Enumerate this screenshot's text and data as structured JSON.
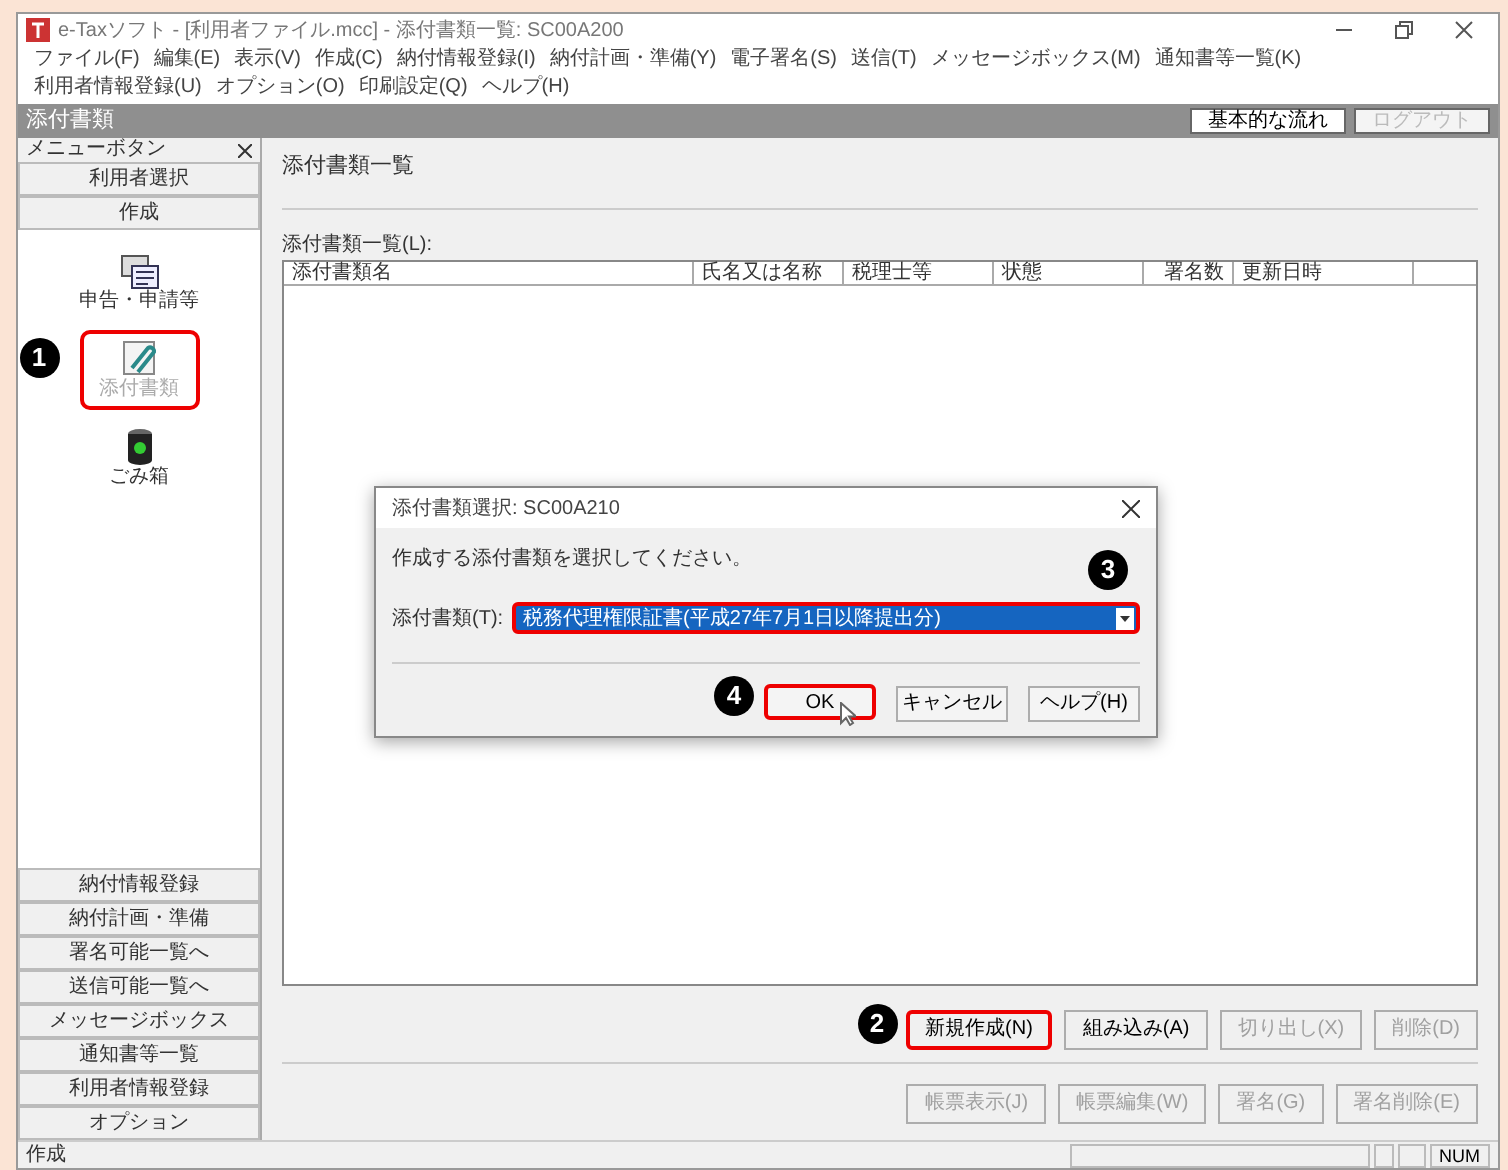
{
  "window": {
    "title": "e-Taxソフト - [利用者ファイル.mcc] - 添付書類一覧: SC00A200"
  },
  "menu": [
    "ファイル(F)",
    "編集(E)",
    "表示(V)",
    "作成(C)",
    "納付情報登録(I)",
    "納付計画・準備(Y)",
    "電子署名(S)",
    "送信(T)",
    "メッセージボックス(M)",
    "通知書等一覧(K)",
    "利用者情報登録(U)",
    "オプション(O)",
    "印刷設定(Q)",
    "ヘルプ(H)"
  ],
  "header": {
    "title": "添付書類",
    "buttons": [
      {
        "label": "基本的な流れ",
        "disabled": false
      },
      {
        "label": "ログアウト",
        "disabled": true
      }
    ]
  },
  "sidebar": {
    "title": "メニューボタン",
    "top_buttons": [
      "利用者選択",
      "作成"
    ],
    "items": [
      {
        "label": "申告・申請等",
        "kind": "forms",
        "selected": false,
        "highlighted": false
      },
      {
        "label": "添付書類",
        "kind": "clip",
        "selected": true,
        "highlighted": true,
        "annotation": "1"
      },
      {
        "label": "ごみ箱",
        "kind": "trash",
        "selected": false,
        "highlighted": false
      }
    ],
    "bottom_buttons": [
      "納付情報登録",
      "納付計画・準備",
      "署名可能一覧へ",
      "送信可能一覧へ",
      "メッセージボックス",
      "通知書等一覧",
      "利用者情報登録",
      "オプション"
    ]
  },
  "content": {
    "title": "添付書類一覧",
    "list_label": "添付書類一覧(L):",
    "table": {
      "columns": [
        "添付書類名",
        "氏名又は名称",
        "税理士等",
        "状態",
        "署名数",
        "更新日時"
      ]
    },
    "buttons_row1": [
      {
        "label": "新規作成(N)",
        "disabled": false,
        "highlighted": true,
        "annotation": "2"
      },
      {
        "label": "組み込み(A)",
        "disabled": false,
        "highlighted": false
      },
      {
        "label": "切り出し(X)",
        "disabled": true,
        "highlighted": false
      },
      {
        "label": "削除(D)",
        "disabled": true,
        "highlighted": false
      }
    ],
    "buttons_row2": [
      {
        "label": "帳票表示(J)",
        "disabled": true,
        "highlighted": false
      },
      {
        "label": "帳票編集(W)",
        "disabled": true,
        "highlighted": false
      },
      {
        "label": "署名(G)",
        "disabled": true,
        "highlighted": false
      },
      {
        "label": "署名削除(E)",
        "disabled": true,
        "highlighted": false
      }
    ]
  },
  "dialog": {
    "title": "添付書類選択: SC00A210",
    "message": "作成する添付書類を選択してください。",
    "field_label": "添付書類(T):",
    "field_value": "税務代理権限証書(平成27年7月1日以降提出分)",
    "field_highlighted": true,
    "field_annotation": "3",
    "buttons": [
      {
        "label": "OK",
        "highlighted": true,
        "annotation": "4"
      },
      {
        "label": "キャンセル",
        "highlighted": false
      },
      {
        "label": "ヘルプ(H)",
        "highlighted": false
      }
    ]
  },
  "status_bar": {
    "text": "作成",
    "indicator": "NUM"
  }
}
